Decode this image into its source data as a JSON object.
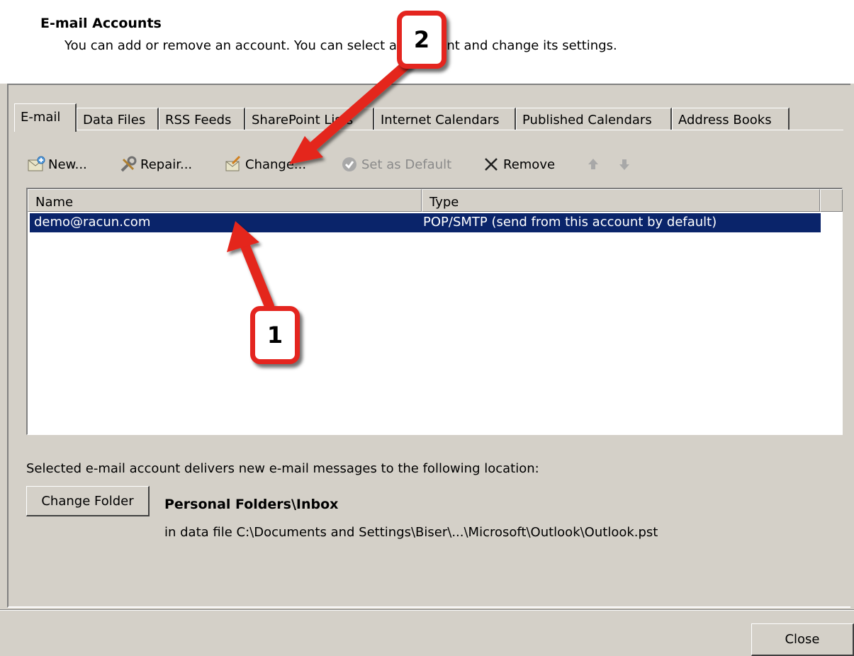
{
  "header": {
    "title": "E-mail Accounts",
    "subtitle": "You can add or remove an account. You can select an account and change its settings."
  },
  "tabs": [
    {
      "label": "E-mail",
      "active": true
    },
    {
      "label": "Data Files"
    },
    {
      "label": "RSS Feeds"
    },
    {
      "label": "SharePoint Lists"
    },
    {
      "label": "Internet Calendars"
    },
    {
      "label": "Published Calendars"
    },
    {
      "label": "Address Books"
    }
  ],
  "toolbar": {
    "new_label": "New...",
    "repair_label": "Repair...",
    "change_label": "Change...",
    "set_default_label": "Set as Default",
    "remove_label": "Remove"
  },
  "accounts_list": {
    "columns": [
      "Name",
      "Type"
    ],
    "rows": [
      {
        "name": "demo@racun.com",
        "type": "POP/SMTP (send from this account by default)",
        "selected": true
      }
    ]
  },
  "delivery": {
    "label": "Selected e-mail account delivers new e-mail messages to the following location:",
    "change_folder_label": "Change Folder",
    "folder": "Personal Folders\\Inbox",
    "data_file": "in data file C:\\Documents and Settings\\Biser\\...\\Microsoft\\Outlook\\Outlook.pst"
  },
  "footer": {
    "close_label": "Close"
  },
  "callouts": [
    {
      "label": "1",
      "color": "#e4251f"
    },
    {
      "label": "2",
      "color": "#e4251f"
    }
  ],
  "colors": {
    "selection": "#0a246a",
    "dialog_bg": "#d4d0c8",
    "callout_red": "#e4251f"
  }
}
